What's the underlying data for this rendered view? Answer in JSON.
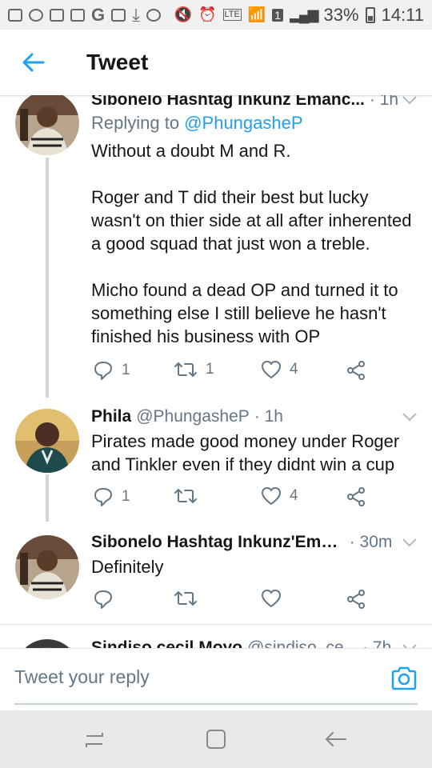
{
  "status_bar": {
    "battery": "33%",
    "time": "14:11",
    "lte_label": "LTE",
    "sim": "1"
  },
  "header": {
    "title": "Tweet"
  },
  "tweets": [
    {
      "name": "Sibonelo Hashtag Inkunz Emanc...",
      "time": "· 1h",
      "replying_prefix": "Replying to",
      "replying_handle": "@PhungasheP",
      "body": "Without a doubt M and R.\n\nRoger and T did their best but lucky wasn't on thier side at all after inherented a good squad that just won a treble.\n\nMicho found a dead OP and turned it to something else I still believe he hasn't finished his business with OP",
      "reply_count": "1",
      "retweet_count": "1",
      "like_count": "4"
    },
    {
      "name": "Phila",
      "handle": "@PhungasheP",
      "time": "· 1h",
      "body": "Pirates made good money under Roger and Tinkler even if they didnt win a cup",
      "reply_count": "1",
      "retweet_count": "",
      "like_count": "4"
    },
    {
      "name": "Sibonelo Hashtag Inkunz'Ema...",
      "time": "· 30m",
      "body": "Definitely",
      "reply_count": "",
      "retweet_count": "",
      "like_count": ""
    },
    {
      "name": "Sindiso cecil Moyo",
      "handle": "@sindiso_ce...",
      "time": "· 7h"
    }
  ],
  "reply_bar": {
    "placeholder": "Tweet your reply"
  },
  "colors": {
    "accent": "#1da1f2",
    "secondary_text": "#657786",
    "primary_text": "#14171a",
    "divider": "#e1e8ed"
  },
  "icons": [
    "back-arrow-icon",
    "chevron-down-icon",
    "reply-icon",
    "retweet-icon",
    "like-icon",
    "share-icon",
    "camera-icon",
    "recents-icon",
    "home-icon",
    "back-icon"
  ]
}
